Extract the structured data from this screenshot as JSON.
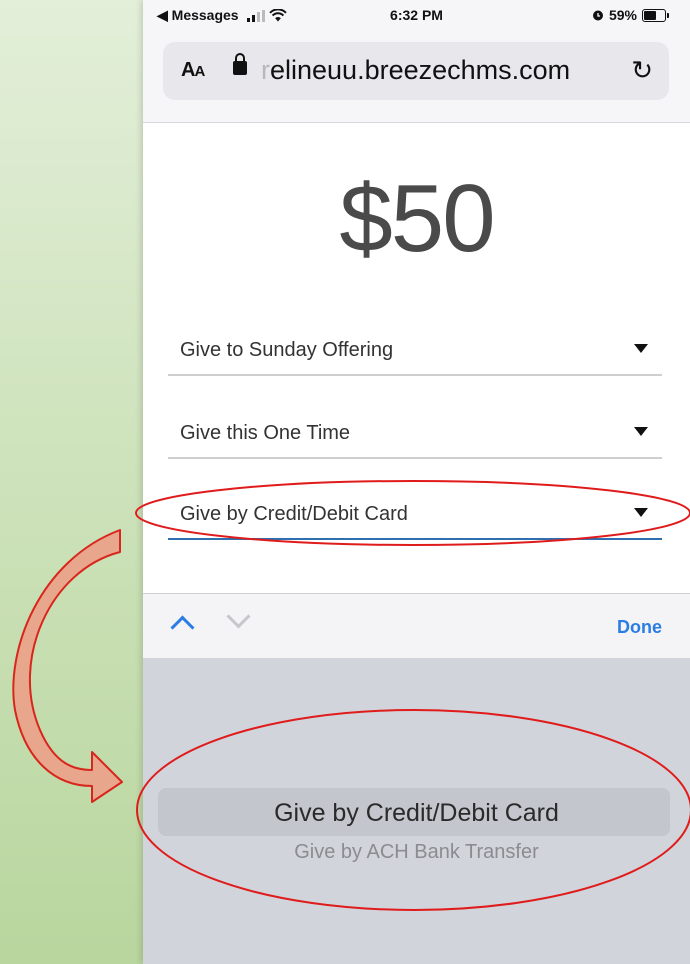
{
  "status_bar": {
    "back_app": "◀ Messages",
    "time": "6:32 PM",
    "battery": "59%"
  },
  "url_bar": {
    "text_size_label": "AA",
    "domain_prefix": "r",
    "domain": "elineuu.breezechms.com",
    "reload_icon": "reload-icon"
  },
  "form": {
    "amount": "$50",
    "fund_select": "Give to Sunday Offering",
    "frequency_select": "Give this One Time",
    "method_select": "Give by Credit/Debit Card"
  },
  "keyboard_accessory": {
    "done_label": "Done"
  },
  "picker": {
    "options": [
      "Give by Credit/Debit Card",
      "Give by ACH Bank Transfer"
    ],
    "selected": "Give by Credit/Debit Card"
  },
  "annotation_colors": {
    "ellipse": "#e01b1b",
    "arrow_fill": "#e8a68c",
    "arrow_stroke": "#d9261c"
  }
}
